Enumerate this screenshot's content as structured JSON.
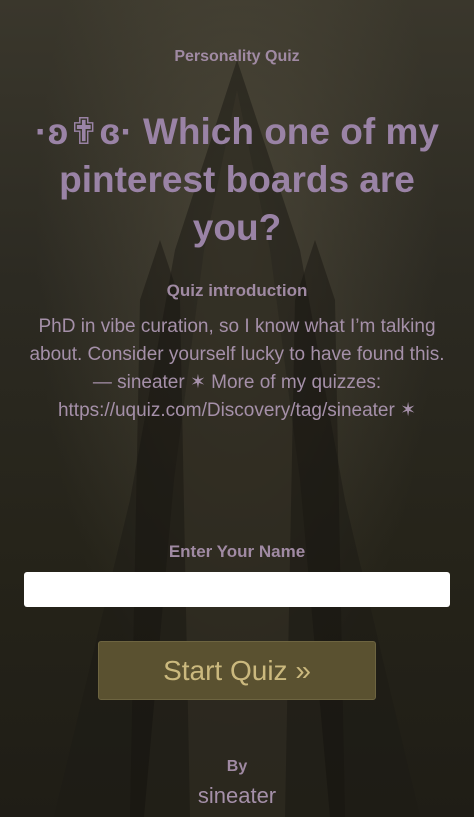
{
  "quiz": {
    "type_label": "Personality Quiz",
    "title": "·ʚ✟ɞ· Which one of my pinterest boards are you?",
    "intro_label": "Quiz introduction",
    "intro_text": "PhD in vibe curation, so I know what I’m talking about. Consider yourself lucky to have found this. — sineater ✶ More of my quizzes: https://uquiz.com/Discovery/tag/sineater ✶",
    "name_label": "Enter Your Name",
    "name_value": "",
    "start_button": "Start Quiz »",
    "by_label": "By",
    "author": "sineater"
  },
  "colors": {
    "text_accent": "#9a83a6",
    "button_bg": "#5a5130",
    "button_text": "#cbb97e"
  }
}
